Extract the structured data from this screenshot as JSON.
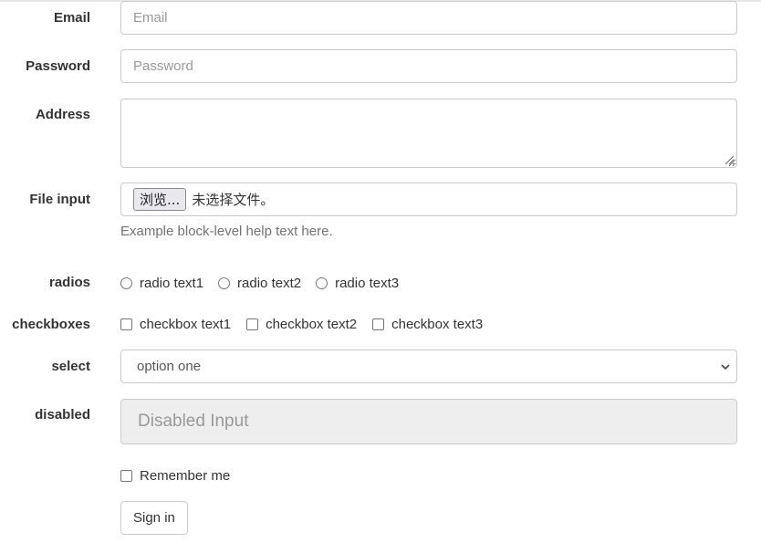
{
  "form": {
    "email": {
      "label": "Email",
      "value": "",
      "placeholder": "Email"
    },
    "password": {
      "label": "Password",
      "value": "",
      "placeholder": "Password"
    },
    "address": {
      "label": "Address",
      "value": ""
    },
    "file_input": {
      "label": "File input",
      "button_label": "浏览...",
      "status": "未选择文件。",
      "help_text": "Example block-level help text here."
    },
    "radios": {
      "label": "radios",
      "options": [
        {
          "label": "radio text1",
          "checked": false
        },
        {
          "label": "radio text2",
          "checked": false
        },
        {
          "label": "radio text3",
          "checked": false
        }
      ]
    },
    "checkboxes": {
      "label": "checkboxes",
      "options": [
        {
          "label": "checkbox text1",
          "checked": false
        },
        {
          "label": "checkbox text2",
          "checked": false
        },
        {
          "label": "checkbox text3",
          "checked": false
        }
      ]
    },
    "select": {
      "label": "select",
      "selected": "option one",
      "icon": "chevron-down-icon"
    },
    "disabled": {
      "label": "disabled",
      "placeholder": "Disabled Input"
    },
    "remember_me": {
      "label": "Remember me",
      "checked": false
    },
    "submit": {
      "label": "Sign in"
    }
  },
  "colors": {
    "border": "#cccccc",
    "label_text": "#333333",
    "help_text": "#737373",
    "disabled_bg": "#eeeeee",
    "placeholder": "#999999"
  }
}
